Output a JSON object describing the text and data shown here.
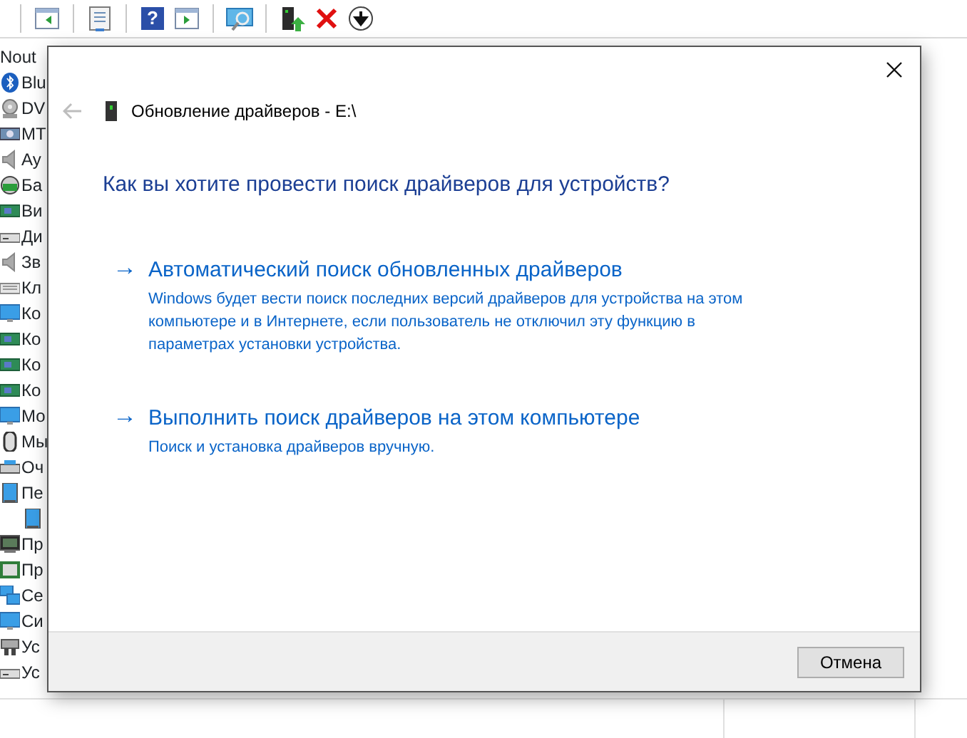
{
  "toolbar": {
    "buttons": [
      {
        "kind": "back"
      },
      {
        "kind": "properties"
      },
      {
        "kind": "help",
        "glyph": "?"
      },
      {
        "kind": "forward"
      },
      {
        "kind": "scan"
      },
      {
        "kind": "update"
      },
      {
        "kind": "remove"
      },
      {
        "kind": "disable"
      }
    ]
  },
  "tree": {
    "label": "Nout",
    "children": [
      {
        "label": "Blu",
        "kind": "bluetooth"
      },
      {
        "label": "DV",
        "kind": "disc"
      },
      {
        "label": "МТ",
        "kind": "camera"
      },
      {
        "label": "Ау",
        "kind": "speaker"
      },
      {
        "label": "Ба",
        "kind": "battery"
      },
      {
        "label": "Ви",
        "kind": "card"
      },
      {
        "label": "Ди",
        "kind": "drive"
      },
      {
        "label": "Зв",
        "kind": "speaker"
      },
      {
        "label": "Кл",
        "kind": "keyboard"
      },
      {
        "label": "Ко",
        "kind": "monitor"
      },
      {
        "label": "Ко",
        "kind": "card"
      },
      {
        "label": "Ко",
        "kind": "card"
      },
      {
        "label": "Ко",
        "kind": "card"
      },
      {
        "label": "Мо",
        "kind": "monitor"
      },
      {
        "label": "Мы",
        "kind": "mouse"
      },
      {
        "label": "Оч",
        "kind": "printer"
      },
      {
        "label": "Пе",
        "kind": "tablet",
        "children": [
          {
            "kind": "tablet"
          }
        ]
      },
      {
        "label": "Пр",
        "kind": "monitor-dark"
      },
      {
        "label": "Пр",
        "kind": "chip"
      },
      {
        "label": "Се",
        "kind": "network"
      },
      {
        "label": "Си",
        "kind": "monitor"
      },
      {
        "label": "Ус",
        "kind": "usb"
      },
      {
        "label": "Ус",
        "kind": "drive"
      }
    ]
  },
  "dialog": {
    "title": "Обновление драйверов - E:\\",
    "back_disabled": true,
    "heading": "Как вы хотите провести поиск драйверов для устройств?",
    "options": [
      {
        "arrow": "→",
        "title": "Автоматический поиск обновленных драйверов",
        "description": "Windows будет вести поиск последних версий драйверов для устройства на этом компьютере и в Интернете, если пользователь не отключил эту функцию в параметрах установки устройства."
      },
      {
        "arrow": "→",
        "title": "Выполнить поиск драйверов на этом компьютере",
        "description": "Поиск и установка драйверов вручную."
      }
    ],
    "buttons": [
      "Отмена"
    ]
  }
}
